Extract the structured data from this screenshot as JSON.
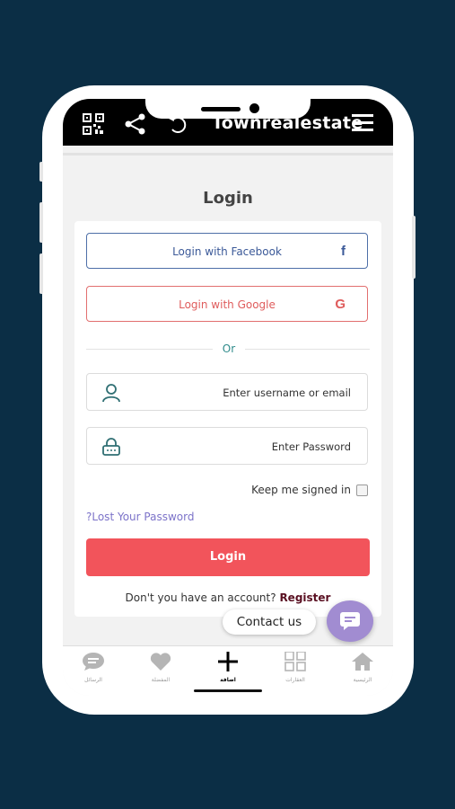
{
  "app": {
    "brand": "Townrealestate"
  },
  "topbar": {
    "icons": [
      "qr-code-icon",
      "share-icon",
      "refresh-icon",
      "menu-icon"
    ]
  },
  "page": {
    "title": "Login"
  },
  "social": {
    "facebook_label": "Login with Facebook",
    "facebook_icon": "f",
    "google_label": "Login with Google",
    "google_icon": "G"
  },
  "divider": {
    "text": "Or"
  },
  "form": {
    "username_placeholder": "Enter username or email",
    "password_placeholder": "Enter Password",
    "keep_signed_in": "Keep me signed in",
    "lost_password": "?Lost Your Password",
    "login_button": "Login",
    "no_account_text": "Don't you have an account?",
    "register_link": "Register"
  },
  "chat": {
    "contact_label": "Contact us"
  },
  "bottom_nav": {
    "items": [
      {
        "label": "الرسائل",
        "icon": "chat-icon"
      },
      {
        "label": "المفضلة",
        "icon": "heart-icon"
      },
      {
        "label": "اضافة",
        "icon": "plus-icon"
      },
      {
        "label": "العقارات",
        "icon": "grid-icon"
      },
      {
        "label": "الرئيسية",
        "icon": "home-icon"
      }
    ],
    "active_index": 2
  },
  "colors": {
    "background": "#0b2e45",
    "facebook": "#3b5998",
    "google": "#df5c5c",
    "login_button": "#f2545b",
    "accent_teal": "#2f8b8b",
    "link_purple": "#7c73c9",
    "chat_fab": "#a18cd1"
  }
}
